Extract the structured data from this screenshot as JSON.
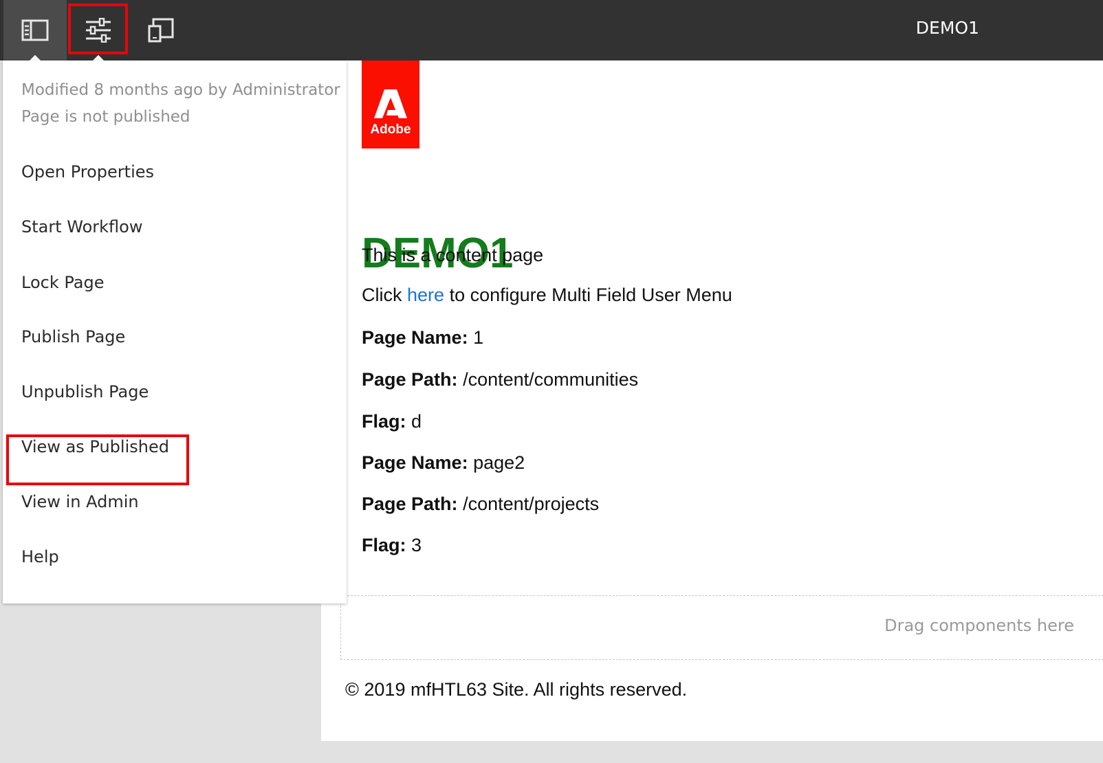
{
  "toolbar": {
    "icons": [
      "side-panel-icon",
      "page-properties-icon",
      "emulator-icon"
    ],
    "page_title": "DEMO1"
  },
  "popover": {
    "modified": "Modified 8 months ago by Administrator",
    "status": "Page is not published",
    "menu": [
      {
        "label": "Open Properties"
      },
      {
        "label": "Start Workflow"
      },
      {
        "label": "Lock Page"
      },
      {
        "label": "Publish Page"
      },
      {
        "label": "Unpublish Page"
      },
      {
        "label": "View as Published",
        "highlighted": true
      },
      {
        "label": "View in Admin"
      },
      {
        "label": "Help"
      }
    ]
  },
  "page": {
    "logo_text": "Adobe",
    "heading": "DEMO1",
    "intro": "This is a content page",
    "config_prefix": "Click",
    "config_link": "here",
    "config_suffix": "to configure Multi Field User Menu",
    "fields": [
      {
        "label": "Page Name:",
        "value": "1"
      },
      {
        "label": "Page Path:",
        "value": "/content/communities"
      },
      {
        "label": "Flag:",
        "value": "d"
      },
      {
        "label": "Page Name:",
        "value": "page2"
      },
      {
        "label": "Page Path:",
        "value": "/content/projects"
      },
      {
        "label": "Flag:",
        "value": "3"
      }
    ],
    "dropzone": "Drag components here",
    "footer": "© 2019 mfHTL63 Site. All rights reserved."
  },
  "colors": {
    "toolbar_bg": "#323232",
    "heading_green": "#137c1c",
    "adobe_red": "#fa0f00",
    "highlight_red": "#e8050a",
    "link_blue": "#1a73d8"
  }
}
